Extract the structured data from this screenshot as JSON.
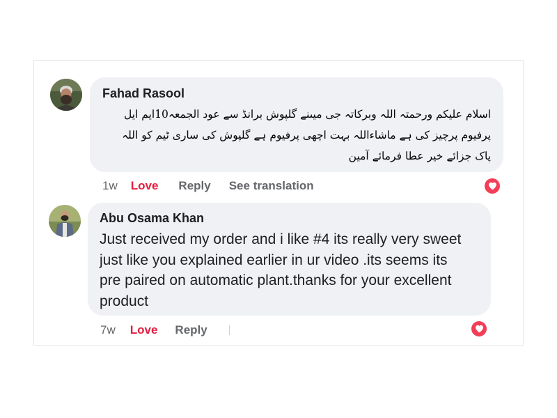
{
  "colors": {
    "bubble": "#eff1f4",
    "love": "#e41e3f",
    "muted": "#65676b",
    "heart": "#f33e58"
  },
  "comments": [
    {
      "author": "Fahad Rasool",
      "text": "اسلام علیکم ورحمتہ اللہ وبرکاتہ جی میںنے گلپوش برانڈ سے عود الجمعہ10ایم ایل پرفیوم پرچیز کی ہے ماشاءاللہ بہت اچھی پرفیوم ہے گلپوش کی ساری ٹیم کو اللہ پاک جزائے خیر عطا فرمائے آمین",
      "time": "1w",
      "love": "Love",
      "reply": "Reply",
      "translate": "See translation",
      "reaction_icon": "heart-icon"
    },
    {
      "author": "Abu Osama Khan",
      "text": "Just received my order and i like #4 its really very sweet just like you explained earlier in ur video .its seems its pre paired on automatic plant.thanks for your excellent product",
      "time": "7w",
      "love": "Love",
      "reply": "Reply",
      "reaction_icon": "heart-icon"
    }
  ]
}
